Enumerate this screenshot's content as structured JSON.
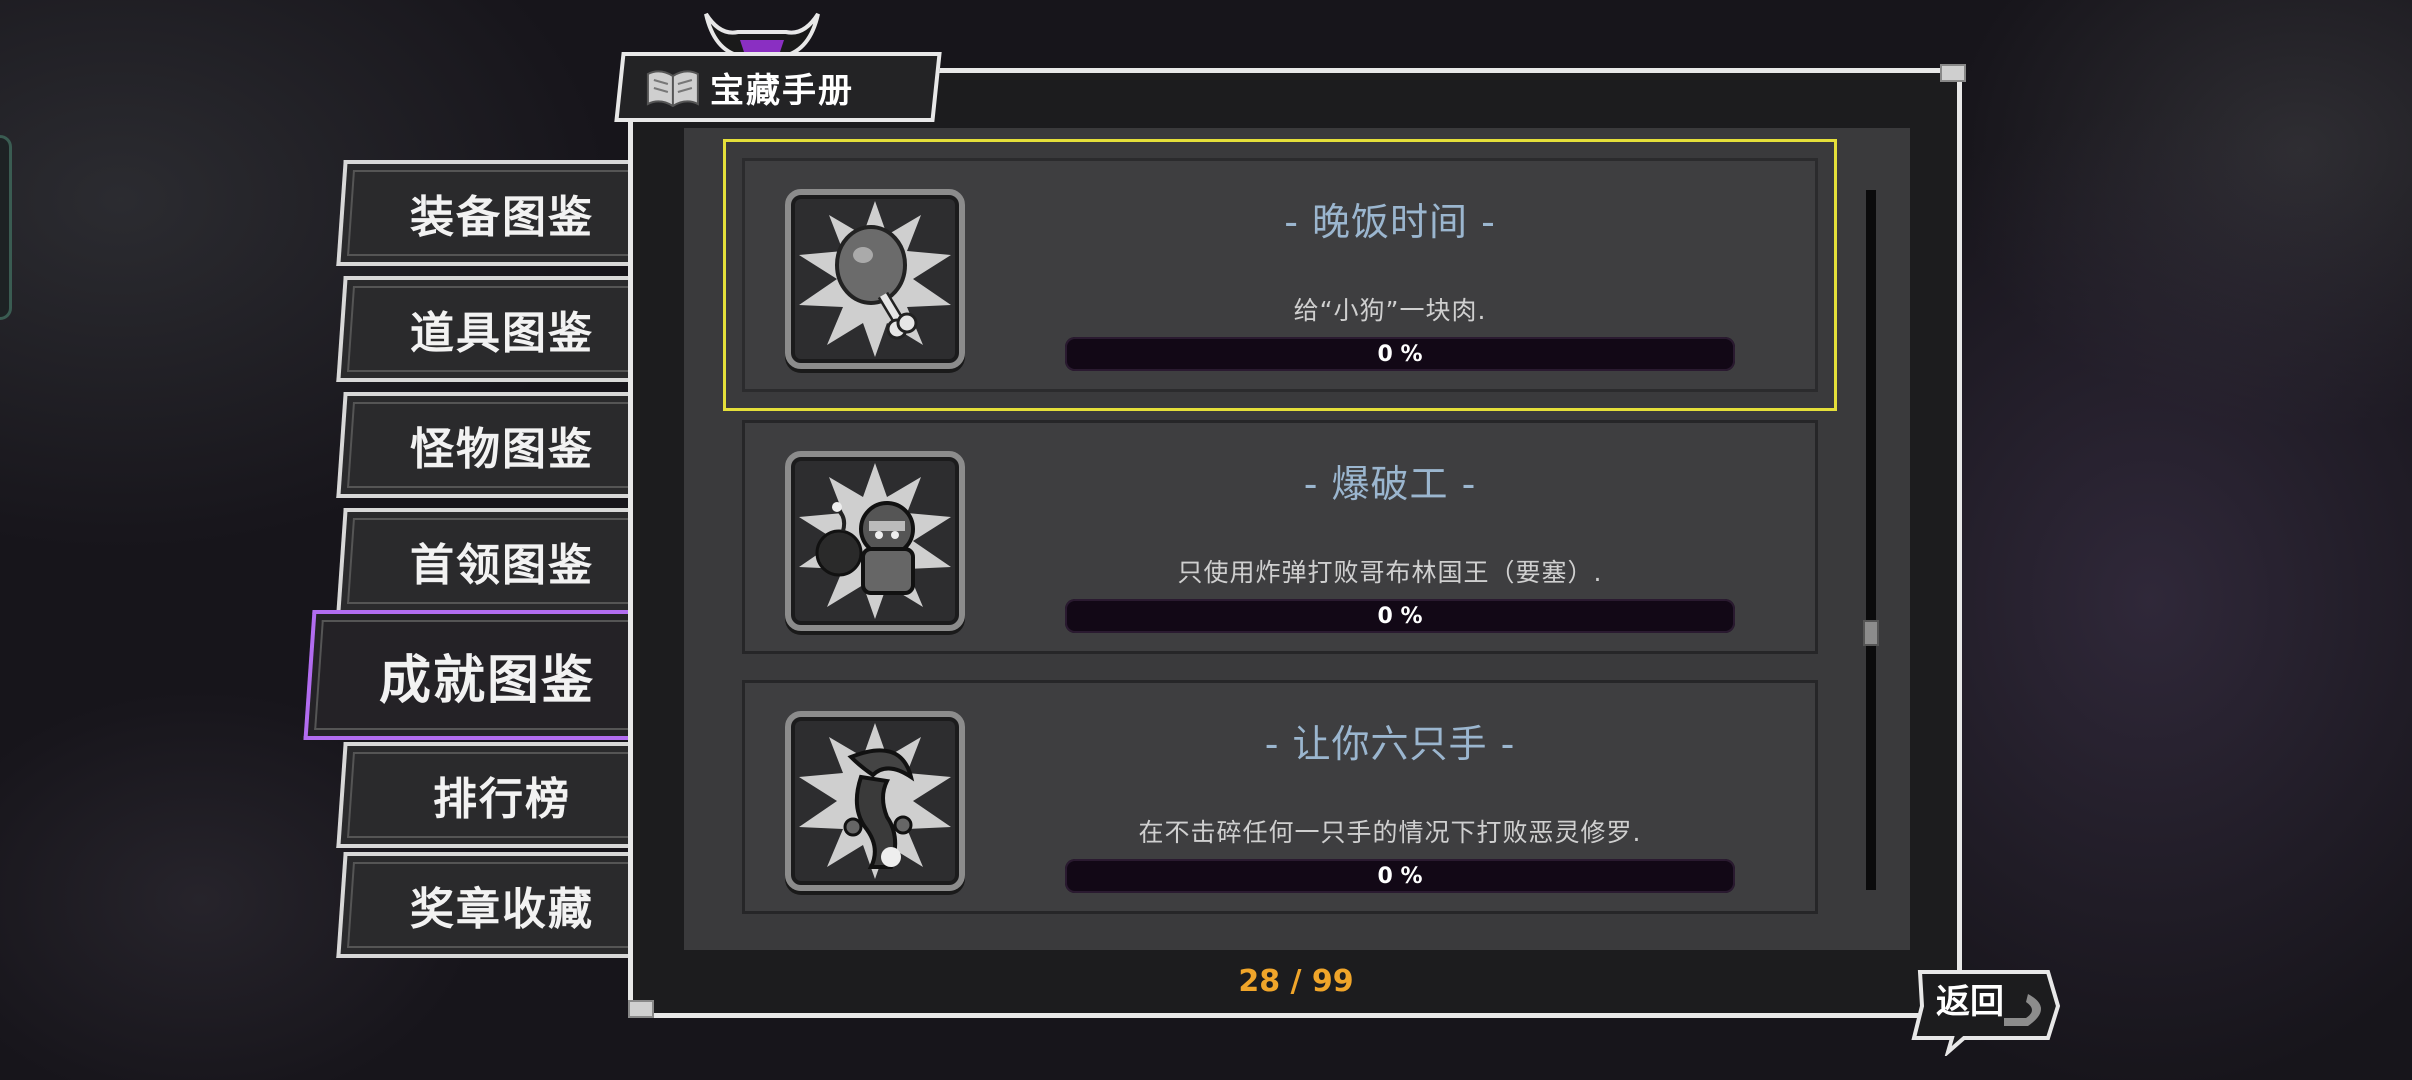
{
  "window": {
    "title": "宝藏手册"
  },
  "menu": {
    "items": [
      {
        "label": "装备图鉴",
        "active": false
      },
      {
        "label": "道具图鉴",
        "active": false
      },
      {
        "label": "怪物图鉴",
        "active": false
      },
      {
        "label": "首领图鉴",
        "active": false
      },
      {
        "label": "成就图鉴",
        "active": true
      },
      {
        "label": "排行榜",
        "active": false
      },
      {
        "label": "奖章收藏",
        "active": false
      }
    ]
  },
  "achievements": [
    {
      "title": "- 晚饭时间 -",
      "desc": "给“小狗”一块肉.",
      "progress": 0,
      "progress_label": "0 %",
      "icon": "meat-drumstick-icon",
      "selected": true
    },
    {
      "title": "- 爆破工 -",
      "desc": "只使用炸弹打败哥布林国王（要塞）.",
      "progress": 0,
      "progress_label": "0 %",
      "icon": "bomber-icon",
      "selected": false
    },
    {
      "title": "- 让你六只手 -",
      "desc": "在不击碎任何一只手的情况下打败恶灵修罗.",
      "progress": 0,
      "progress_label": "0 %",
      "icon": "six-hands-demon-icon",
      "selected": false
    }
  ],
  "pagination": {
    "label": "28 / 99"
  },
  "back_button": {
    "label": "返回"
  },
  "colors": {
    "active_tab": "#b26cf0",
    "selected_outline": "#e4df3a",
    "title_text": "#9bb6cf",
    "page_counter": "#f0a52a"
  }
}
